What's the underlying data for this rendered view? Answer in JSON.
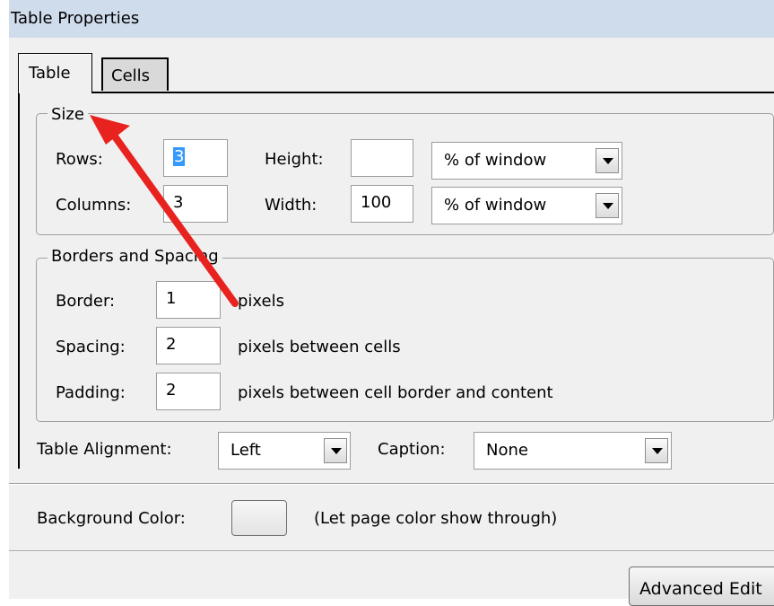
{
  "window": {
    "title": "Table Properties"
  },
  "tabs": [
    {
      "label": "Table",
      "active": true
    },
    {
      "label": "Cells",
      "active": false
    }
  ],
  "size_group": {
    "legend": "Size",
    "rows": {
      "label": "Rows:",
      "value": "3"
    },
    "columns": {
      "label": "Columns:",
      "value": "3"
    },
    "height": {
      "label": "Height:",
      "value": "",
      "unit": "% of window"
    },
    "width": {
      "label": "Width:",
      "value": "100",
      "unit": "% of window"
    }
  },
  "borders_group": {
    "legend": "Borders and Spacing",
    "border": {
      "label": "Border:",
      "value": "1",
      "suffix": "pixels"
    },
    "spacing": {
      "label": "Spacing:",
      "value": "2",
      "suffix": "pixels between cells"
    },
    "padding": {
      "label": "Padding:",
      "value": "2",
      "suffix": "pixels between cell border and content"
    }
  },
  "alignment": {
    "label": "Table Alignment:",
    "value": "Left"
  },
  "caption": {
    "label": "Caption:",
    "value": "None"
  },
  "background": {
    "label": "Background Color:",
    "note": "(Let page color show through)",
    "swatch_color": "#e3e3e3"
  },
  "buttons": {
    "advanced_edit": "Advanced Edit"
  },
  "annotation": {
    "arrow_color": "#e8231f",
    "points_to": "Size"
  }
}
